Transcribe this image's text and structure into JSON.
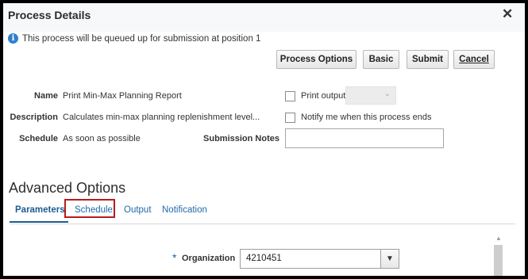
{
  "dialog": {
    "title": "Process Details",
    "close_symbol": "✕",
    "info_message": "This process will be queued up for submission at position 1"
  },
  "buttons": {
    "process_options": "Process Options",
    "basic": "Basic",
    "submit": "Submit",
    "cancel": "Cancel"
  },
  "details": {
    "name_label": "Name",
    "name_value": "Print Min-Max Planning Report",
    "description_label": "Description",
    "description_value": "Calculates min-max planning replenishment level...",
    "schedule_label": "Schedule",
    "schedule_value": "As soon as possible",
    "submission_notes_label": "Submission Notes",
    "submission_notes_value": ""
  },
  "options": {
    "print_output_label": "Print output",
    "print_output_checked": false,
    "notify_label": "Notify me when this process ends",
    "notify_checked": false
  },
  "advanced": {
    "heading": "Advanced Options",
    "tabs": [
      {
        "label": "Parameters",
        "active": true
      },
      {
        "label": "Schedule",
        "active": false
      },
      {
        "label": "Output",
        "active": false
      },
      {
        "label": "Notification",
        "active": false
      }
    ]
  },
  "parameters": {
    "organization_required_mark": "*",
    "organization_label": "Organization",
    "organization_value": "4210451"
  },
  "colors": {
    "info_icon": "#2f7fd0",
    "tab_text": "#1f6aa8",
    "highlight_box": "#b71c1c",
    "frame_border": "#000000"
  },
  "icons": {
    "info": "info-icon",
    "close": "close-icon",
    "dropdown": "chevron-down-icon"
  }
}
